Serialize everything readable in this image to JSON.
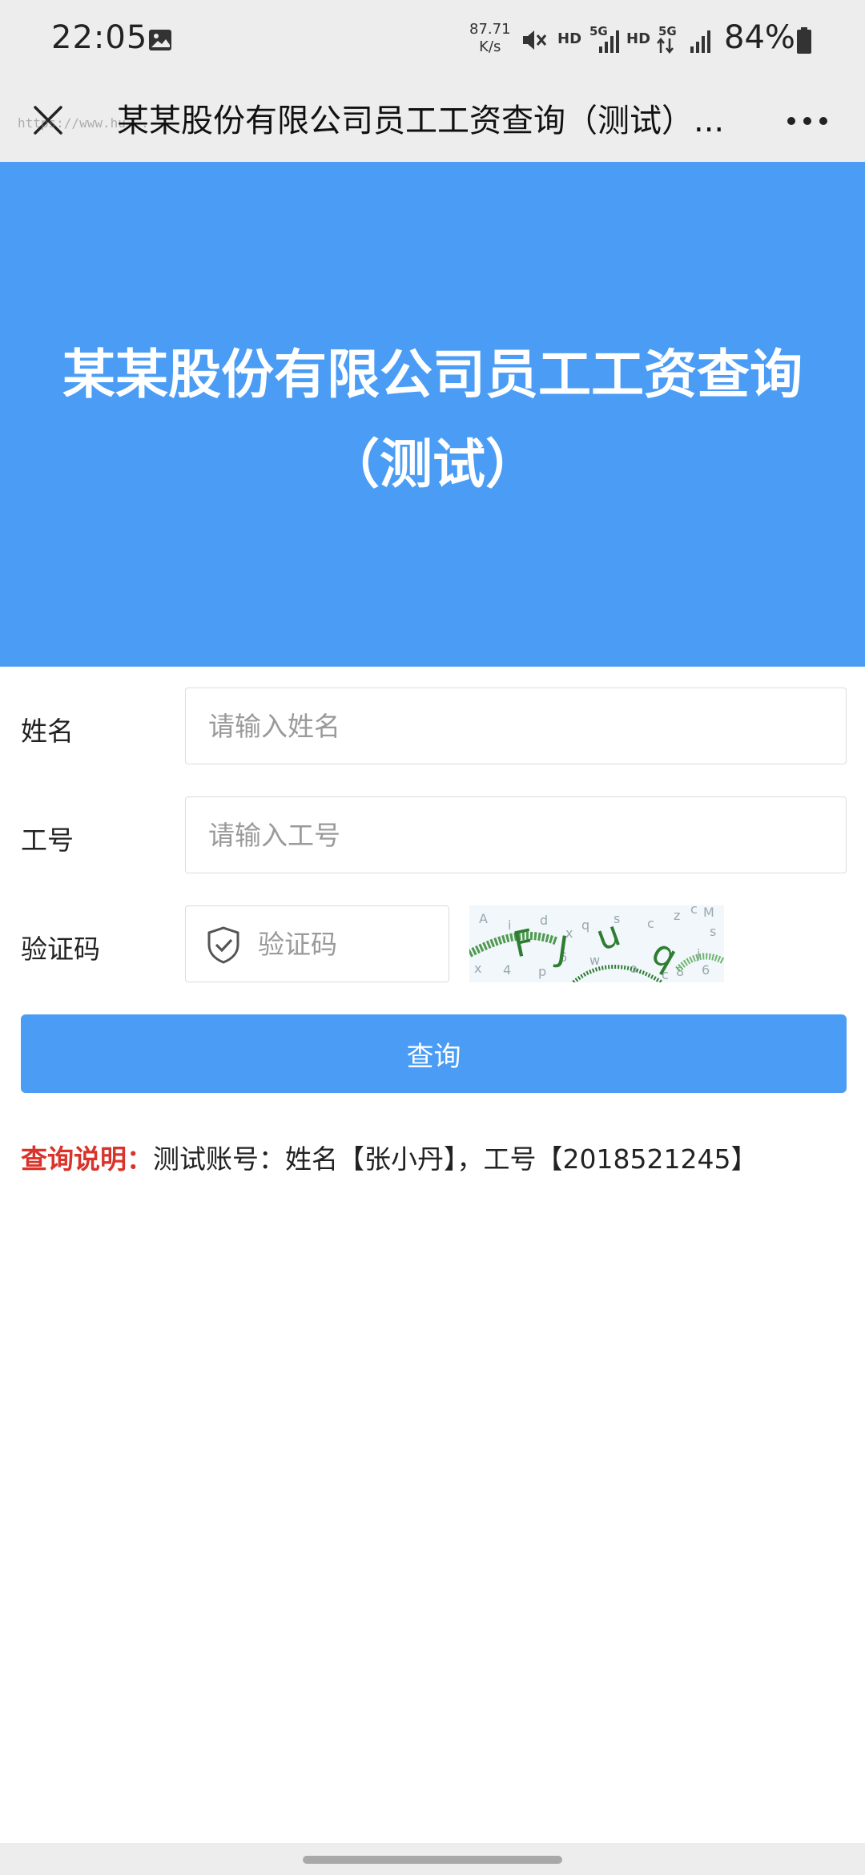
{
  "status_bar": {
    "time": "22:05",
    "speed_value": "87.71",
    "speed_unit": "K/s",
    "hd1": "HD",
    "hd2": "HD",
    "net1": "5G",
    "net2": "5G",
    "battery": "84%",
    "icons": [
      "image-icon",
      "mute-icon",
      "signal-icon",
      "battery-icon"
    ]
  },
  "title_bar": {
    "title": "某某股份有限公司员工工资查询（测试）...",
    "url_watermark": "https://www.hu..."
  },
  "hero": {
    "title_line1": "某某股份有限公司员工工资查询",
    "title_line2": "（测试）"
  },
  "form": {
    "name_label": "姓名",
    "name_placeholder": "请输入姓名",
    "name_value": "",
    "id_label": "工号",
    "id_placeholder": "请输入工号",
    "id_value": "",
    "captcha_label": "验证码",
    "captcha_placeholder": "验证码",
    "captcha_value": "",
    "query_button": "查询"
  },
  "note": {
    "label": "查询说明：",
    "text": "测试账号：姓名【张小丹】，工号【2018521245】"
  },
  "colors": {
    "accent": "#4a9cf5",
    "note_label": "#d9342b",
    "bar_bg": "#ededed"
  }
}
